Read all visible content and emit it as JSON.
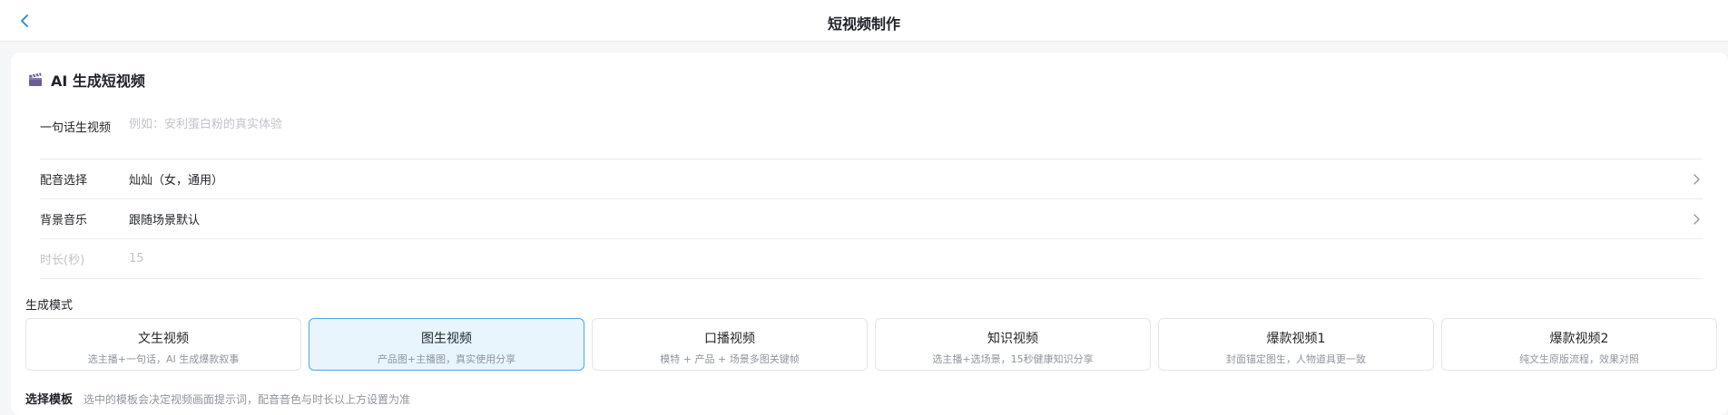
{
  "header": {
    "title": "短视频制作",
    "back_icon": "chevron-left-icon"
  },
  "section": {
    "title": "AI 生成短视频",
    "icon": "clapperboard-icon"
  },
  "form": {
    "prompt": {
      "label": "一句话生视频",
      "value": "",
      "placeholder": "例如：安利蛋白粉的真实体验"
    },
    "voice": {
      "label": "配音选择",
      "value": "灿灿（女，通用）"
    },
    "music": {
      "label": "背景音乐",
      "value": "跟随场景默认"
    },
    "duration": {
      "label": "时长(秒)",
      "value": "15"
    }
  },
  "modes": {
    "label": "生成模式",
    "selected": "图生视频",
    "items": [
      {
        "title": "文生视频",
        "subtitle": "选主播+一句话，AI 生成爆款叙事"
      },
      {
        "title": "图生视频",
        "subtitle": "产品图+主播图，真实使用分享"
      },
      {
        "title": "口播视频",
        "subtitle": "模特 + 产品 + 场景多图关键帧"
      },
      {
        "title": "知识视频",
        "subtitle": "选主播+选场景，15秒健康知识分享"
      },
      {
        "title": "爆款视频1",
        "subtitle": "封面锚定图生，人物道具更一致"
      },
      {
        "title": "爆款视频2",
        "subtitle": "纯文生原版流程，效果对照"
      }
    ]
  },
  "template": {
    "label": "选择模板",
    "hint": "选中的模板会决定视频画面提示词，配音音色与时长以上方设置为准"
  },
  "colors": {
    "accent": "#4aa8e8",
    "active_bg": "#e8f5fc",
    "back_icon": "#1e88e5"
  }
}
